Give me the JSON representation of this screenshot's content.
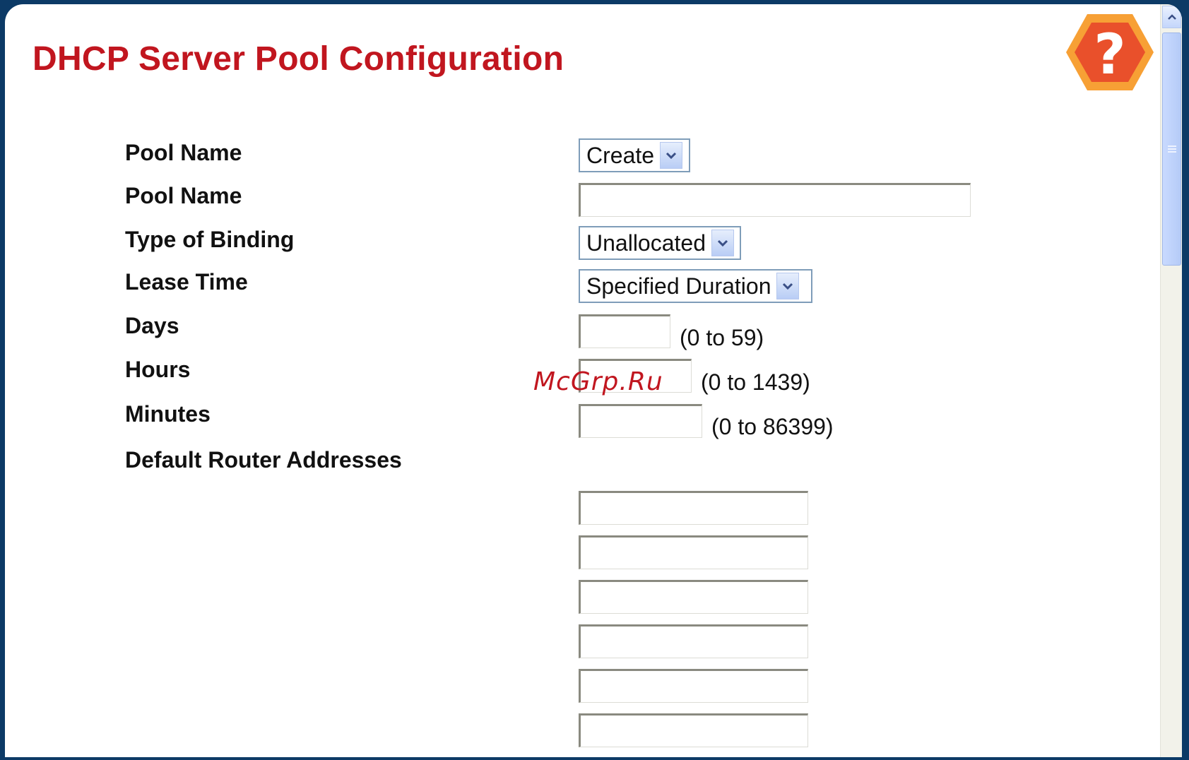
{
  "page": {
    "title": "DHCP Server Pool Configuration"
  },
  "watermark": "McGrp.Ru",
  "help": {
    "glyph": "?",
    "icon": "help-icon",
    "colors": {
      "outer": "#f7a035",
      "inner": "#e9502b"
    }
  },
  "form": {
    "pool_select": {
      "label": "Pool Name",
      "value": "Create"
    },
    "pool_name": {
      "label": "Pool Name",
      "value": ""
    },
    "binding": {
      "label": "Type of Binding",
      "value": "Unallocated"
    },
    "lease_time": {
      "label": "Lease Time",
      "value": "Specified Duration"
    },
    "days": {
      "label": "Days",
      "value": "",
      "hint": "(0 to 59)"
    },
    "hours": {
      "label": "Hours",
      "value": "",
      "hint": "(0 to 1439)"
    },
    "minutes": {
      "label": "Minutes",
      "value": "",
      "hint": "(0 to 86399)"
    },
    "default_router": {
      "label": "Default Router Addresses",
      "addresses": [
        "",
        "",
        "",
        "",
        "",
        ""
      ]
    }
  },
  "colors": {
    "title": "#c1161f",
    "background": "#0c3a66",
    "select_border": "#7f9db9"
  }
}
